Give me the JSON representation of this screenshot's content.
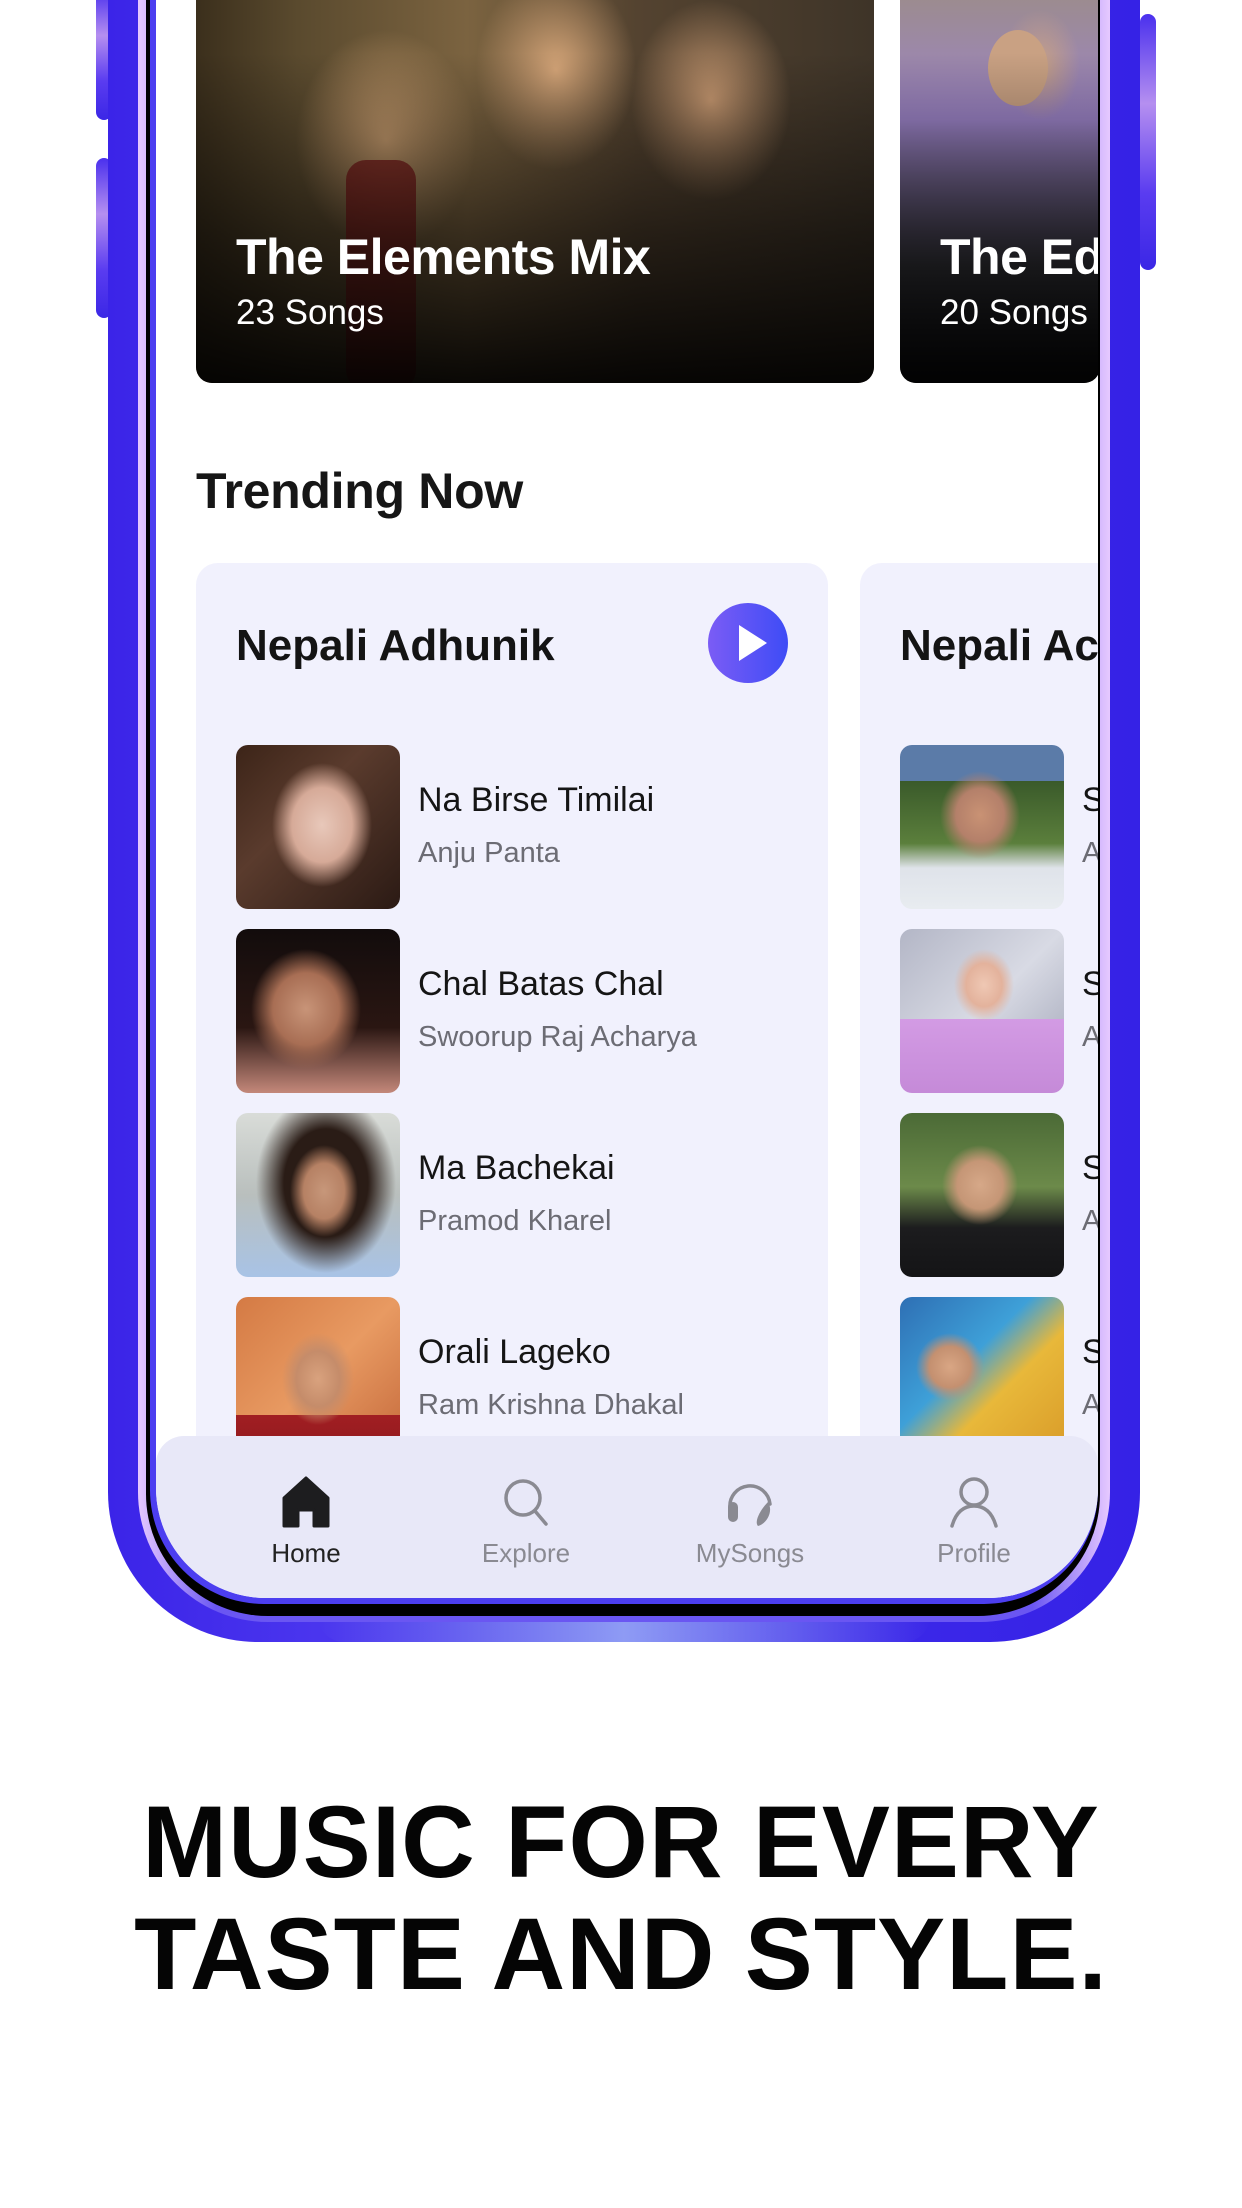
{
  "mixes": [
    {
      "title": "The Elements Mix",
      "count": "23 Songs"
    },
    {
      "title": "The Ed",
      "count": "20 Songs"
    }
  ],
  "trending": {
    "section_title": "Trending Now",
    "cards": [
      {
        "title": "Nepali Adhunik",
        "songs": [
          {
            "title": "Na Birse Timilai",
            "artist": "Anju Panta"
          },
          {
            "title": "Chal Batas Chal",
            "artist": "Swoorup Raj Acharya"
          },
          {
            "title": "Ma Bachekai",
            "artist": "Pramod Kharel"
          },
          {
            "title": "Orali Lageko",
            "artist": "Ram Krishna Dhakal"
          }
        ]
      },
      {
        "title": "Nepali Ac",
        "songs": [
          {
            "title": "S",
            "artist": "A"
          },
          {
            "title": "S",
            "artist": "A"
          },
          {
            "title": "S",
            "artist": "A"
          },
          {
            "title": "S",
            "artist": "A"
          }
        ]
      }
    ]
  },
  "nav": {
    "items": [
      {
        "label": "Home",
        "icon": "home-icon",
        "active": true
      },
      {
        "label": "Explore",
        "icon": "search-icon",
        "active": false
      },
      {
        "label": "MySongs",
        "icon": "headphones-icon",
        "active": false
      },
      {
        "label": "Profile",
        "icon": "user-icon",
        "active": false
      }
    ]
  },
  "headline": {
    "line1": "MUSIC FOR EVERY",
    "line2": "TASTE AND STYLE."
  },
  "colors": {
    "frame": "#3b24e8",
    "accent_gradient_start": "#7b5cf5",
    "accent_gradient_end": "#3e4cf6",
    "card_bg": "#f1f1fd",
    "nav_bg": "#e8e8f8"
  }
}
